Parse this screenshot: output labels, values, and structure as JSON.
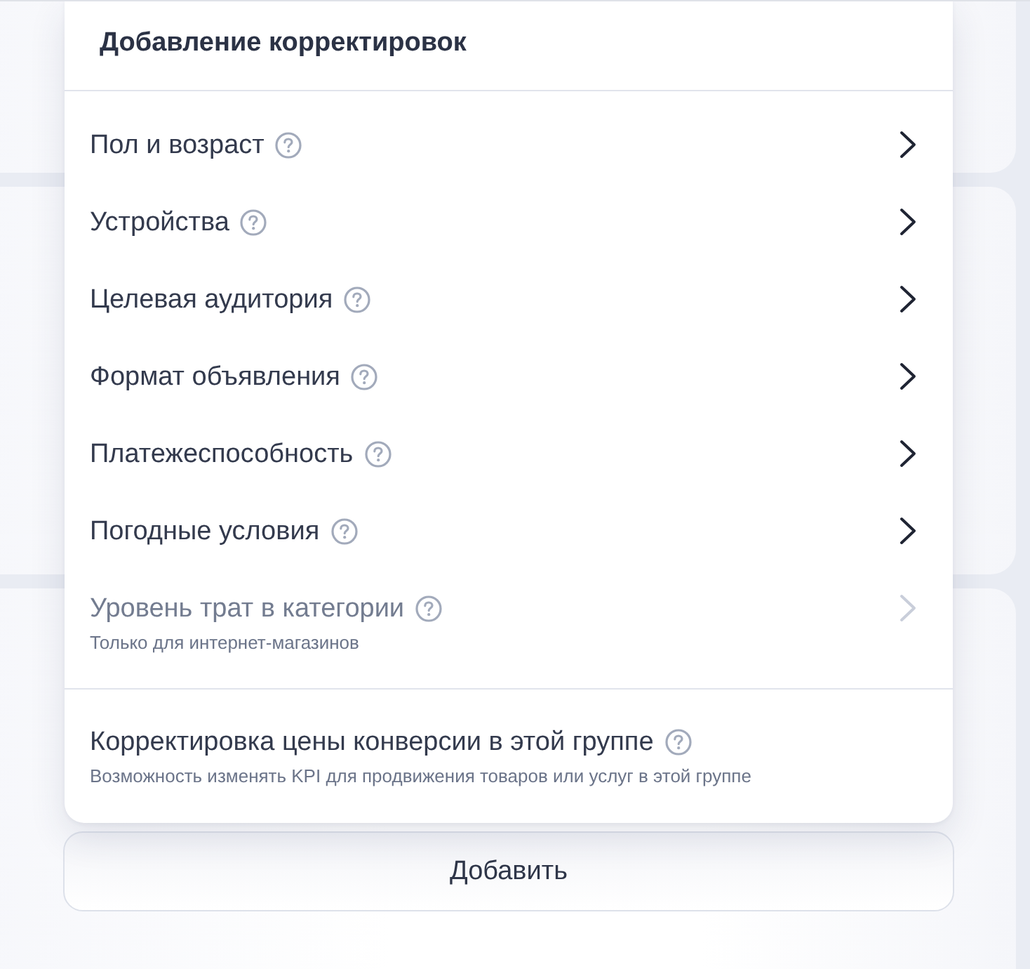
{
  "dialog": {
    "title": "Добавление корректировок",
    "items": [
      {
        "label": "Пол и возраст",
        "disabled": false
      },
      {
        "label": "Устройства",
        "disabled": false
      },
      {
        "label": "Целевая аудитория",
        "disabled": false
      },
      {
        "label": "Формат объявления",
        "disabled": false
      },
      {
        "label": "Платежеспособность",
        "disabled": false
      },
      {
        "label": "Погодные условия",
        "disabled": false
      },
      {
        "label": "Уровень трат в категории",
        "disabled": true,
        "note": "Только для интернет-магазинов"
      }
    ],
    "footer_item": {
      "label": "Корректировка цены конверсии в этой группе",
      "note": "Возможность изменять KPI для продвижения товаров или услуг в этой группе"
    }
  },
  "add_button": {
    "label": "Добавить"
  }
}
